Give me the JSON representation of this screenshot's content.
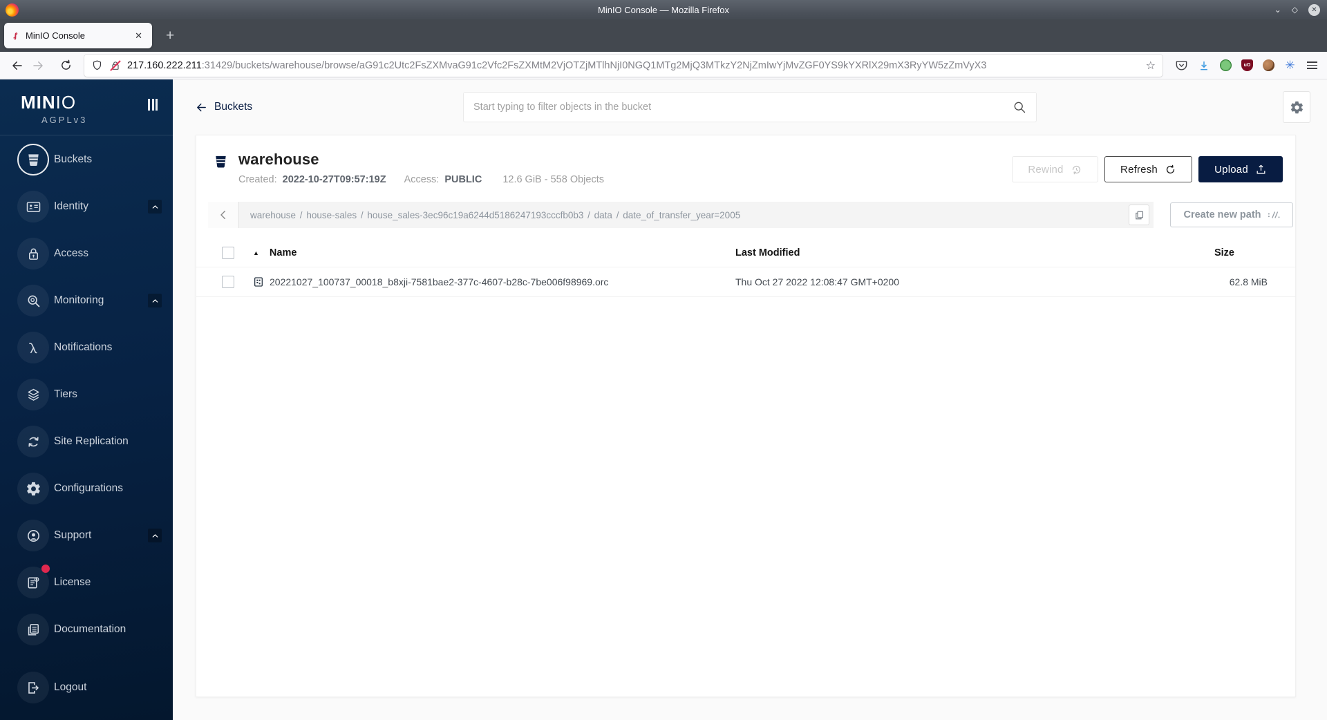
{
  "window": {
    "title": "MinIO Console — Mozilla Firefox"
  },
  "browser": {
    "tab_title": "MinIO Console",
    "url_host": "217.160.222.211",
    "url_rest": ":31429/buckets/warehouse/browse/aG91c2Utc2FsZXMvaG91c2Vfc2FsZXMtM2VjOTZjMTlhNjI0NGQ1MTg2MjQ3MTkzY2NjZmIwYjMvZGF0YS9kYXRlX29mX3RyYW5zZmVyX3"
  },
  "sidebar": {
    "logo_bold": "MIN",
    "logo_thin": "IO",
    "logo_sub": "AGPLv3",
    "items": [
      {
        "id": "buckets",
        "label": "Buckets",
        "icon": "bucket",
        "active": true
      },
      {
        "id": "identity",
        "label": "Identity",
        "icon": "idcard",
        "expandable": true
      },
      {
        "id": "access",
        "label": "Access",
        "icon": "lock"
      },
      {
        "id": "monitoring",
        "label": "Monitoring",
        "icon": "magnify",
        "expandable": true
      },
      {
        "id": "notifications",
        "label": "Notifications",
        "icon": "lambda"
      },
      {
        "id": "tiers",
        "label": "Tiers",
        "icon": "layers"
      },
      {
        "id": "site-replication",
        "label": "Site Replication",
        "icon": "sync"
      },
      {
        "id": "configurations",
        "label": "Configurations",
        "icon": "gear"
      },
      {
        "id": "support",
        "label": "Support",
        "icon": "support",
        "expandable": true
      },
      {
        "id": "license",
        "label": "License",
        "icon": "license",
        "badge": true
      },
      {
        "id": "documentation",
        "label": "Documentation",
        "icon": "docs"
      },
      {
        "id": "logout",
        "label": "Logout",
        "icon": "logout",
        "gap_before": true
      }
    ]
  },
  "header": {
    "back_label": "Buckets",
    "search_placeholder": "Start typing to filter objects in the bucket"
  },
  "bucket": {
    "name": "warehouse",
    "created_label": "Created:",
    "created_value": "2022-10-27T09:57:19Z",
    "access_label": "Access:",
    "access_value": "PUBLIC",
    "usage": "12.6 GiB - 558 Objects",
    "rewind_label": "Rewind",
    "refresh_label": "Refresh",
    "upload_label": "Upload"
  },
  "breadcrumb": {
    "parts": [
      "warehouse",
      "house-sales",
      "house_sales-3ec96c19a6244d5186247193cccfb0b3",
      "data",
      "date_of_transfer_year=2005"
    ],
    "create_new_path_label": "Create new path"
  },
  "table": {
    "name_header": "Name",
    "modified_header": "Last Modified",
    "size_header": "Size",
    "rows": [
      {
        "name": "20221027_100737_00018_b8xji-7581bae2-377c-4607-b28c-7be006f98969.orc",
        "modified": "Thu Oct 27 2022 12:08:47 GMT+0200",
        "size": "62.8 MiB"
      }
    ]
  },
  "colors": {
    "brand_navy": "#081C42",
    "sidebar_top": "#0b2c50",
    "badge_red": "#e0284f"
  }
}
